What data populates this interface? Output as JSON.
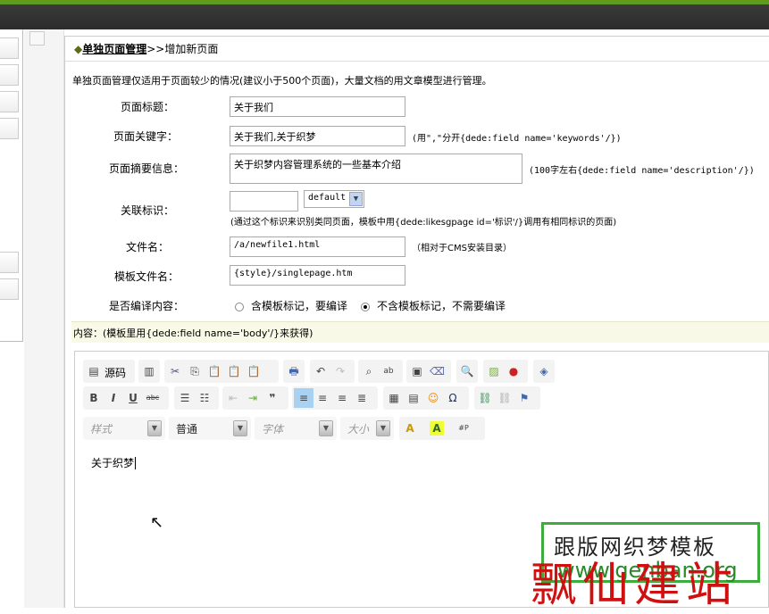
{
  "breadcrumb": {
    "section": "单独页面管理",
    "separator": ">>",
    "current": "增加新页面"
  },
  "intro": "单独页面管理仅适用于页面较少的情况(建议小于500个页面)，大量文档的用文章模型进行管理。",
  "form": {
    "title": {
      "label": "页面标题：",
      "value": "关于我们"
    },
    "keywords": {
      "label": "页面关键字：",
      "value": "关于我们,关于织梦",
      "hint": "(用\",\"分开{dede:field name='keywords'/})"
    },
    "description": {
      "label": "页面摘要信息：",
      "value": "关于织梦内容管理系统的一些基本介绍",
      "hint": "(100字左右{dede:field name='description'/})"
    },
    "likeid": {
      "label": "关联标识：",
      "value": "",
      "select": "default",
      "hint": "(通过这个标识来识别类同页面，模板中用{dede:likesgpage id='标识'/}调用有相同标识的页面)"
    },
    "filename": {
      "label": "文件名：",
      "value": "/a/newfile1.html",
      "hint": "（相对于CMS安装目录）"
    },
    "template": {
      "label": "模板文件名：",
      "value": "{style}/singlepage.htm"
    },
    "compile": {
      "label": "是否编译内容：",
      "options": [
        "含模板标记，要编译",
        "不含模板标记，不需要编译"
      ],
      "selected": 1
    }
  },
  "content_label": "内容：(模板里用{dede:field name='body'/}来获得)",
  "editor": {
    "source_label": "源码",
    "combos": {
      "style": "样式",
      "format": "普通",
      "font": "字体",
      "size": "大小"
    },
    "body": "关于织梦"
  },
  "watermark": {
    "line1": "跟版网织梦模板",
    "line2": "www.genban.org",
    "overlay": "飘仙建站"
  }
}
